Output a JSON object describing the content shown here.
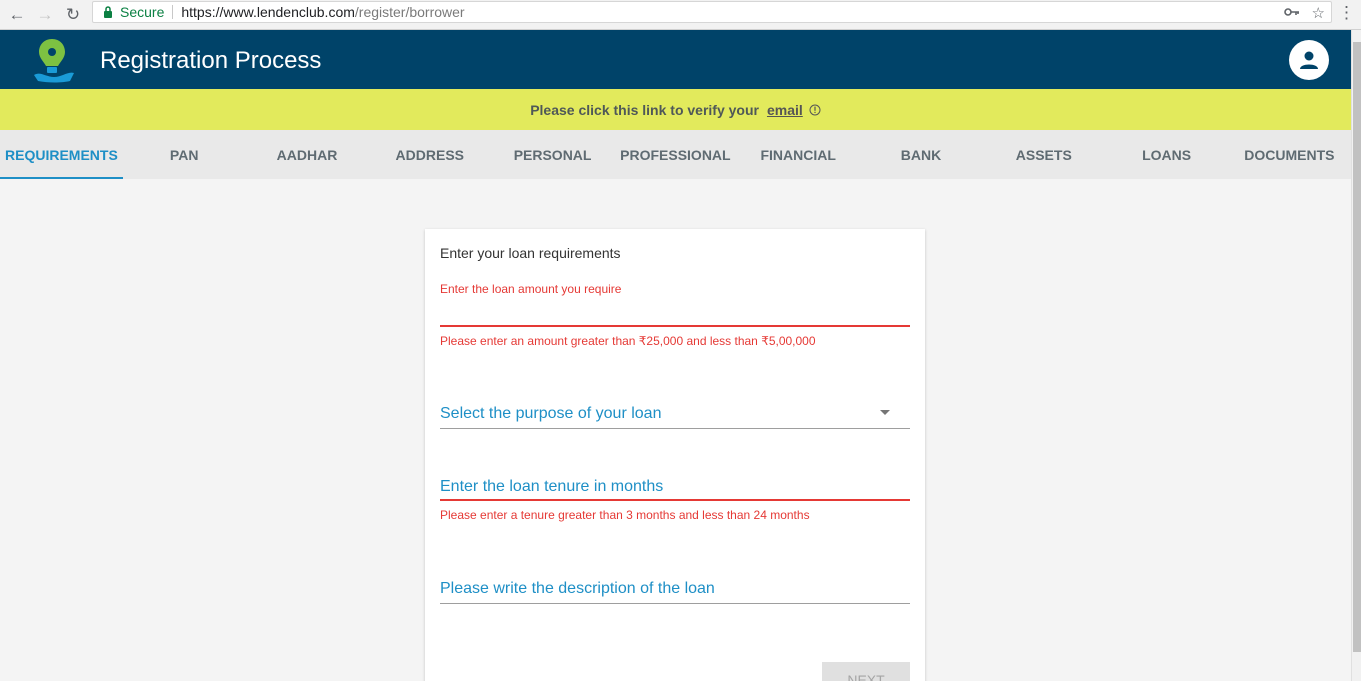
{
  "browser": {
    "secure_label": "Secure",
    "url_host": "https://www.lendenclub.com",
    "url_path": "/register/borrower"
  },
  "header": {
    "title": "Registration Process"
  },
  "banner": {
    "text": "Please click this link to verify your",
    "link": "email"
  },
  "tabs": [
    {
      "label": "REQUIREMENTS",
      "active": true
    },
    {
      "label": "PAN"
    },
    {
      "label": "AADHAR"
    },
    {
      "label": "ADDRESS"
    },
    {
      "label": "PERSONAL"
    },
    {
      "label": "PROFESSIONAL"
    },
    {
      "label": "FINANCIAL"
    },
    {
      "label": "BANK"
    },
    {
      "label": "ASSETS"
    },
    {
      "label": "LOANS"
    },
    {
      "label": "DOCUMENTS"
    }
  ],
  "form": {
    "title": "Enter your loan requirements",
    "amount": {
      "label": "Enter the loan amount you require",
      "error": "Please enter an amount greater than ₹25,000 and less than ₹5,00,000"
    },
    "purpose": {
      "placeholder": "Select the purpose of your loan"
    },
    "tenure": {
      "placeholder": "Enter the loan tenure in months",
      "error": "Please enter a tenure greater than 3 months and less than 24 months"
    },
    "description": {
      "placeholder": "Please write the description of the loan"
    },
    "next_label": "NEXT"
  },
  "colors": {
    "header_bg": "#004369",
    "banner_bg": "#e2ea5c",
    "accent": "#1e8fc6",
    "error": "#e53935"
  }
}
